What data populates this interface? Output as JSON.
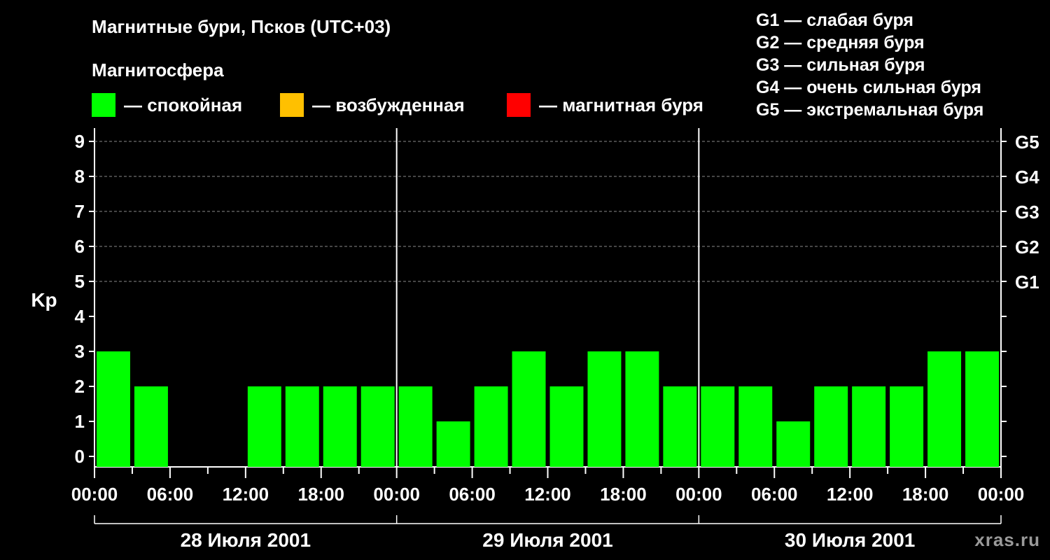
{
  "title": "Магнитные бури, Псков (UTC+03)",
  "subtitle": "Магнитосфера",
  "legend": [
    {
      "label": "— спокойная",
      "color": "#00ff00"
    },
    {
      "label": "— возбужденная",
      "color": "#ffc000"
    },
    {
      "label": "— магнитная буря",
      "color": "#ff0000"
    }
  ],
  "g_legend": [
    "G1 — слабая буря",
    "G2 — средняя буря",
    "G3 — сильная буря",
    "G4 — очень сильная буря",
    "G5 — экстремальная буря"
  ],
  "watermark": "xras.ru",
  "chart_data": {
    "type": "bar",
    "ylabel": "Kp",
    "ylim": [
      0,
      9
    ],
    "yticks": [
      0,
      1,
      2,
      3,
      4,
      5,
      6,
      7,
      8,
      9
    ],
    "right_axis": [
      {
        "kp": 5,
        "label": "G1"
      },
      {
        "kp": 6,
        "label": "G2"
      },
      {
        "kp": 7,
        "label": "G3"
      },
      {
        "kp": 8,
        "label": "G4"
      },
      {
        "kp": 9,
        "label": "G5"
      }
    ],
    "grid": "dashed horizontal lines at Kp 5–9",
    "x_tick_labels": [
      "00:00",
      "06:00",
      "12:00",
      "18:00",
      "00:00",
      "06:00",
      "12:00",
      "18:00",
      "00:00",
      "06:00",
      "12:00",
      "18:00",
      "00:00"
    ],
    "days": [
      "28 Июля 2001",
      "29 Июля 2001",
      "30 Июля 2001"
    ],
    "bar_interval_hours": 3,
    "color": "#00ff00",
    "values": [
      3,
      2,
      0,
      0,
      2,
      2,
      2,
      2,
      2,
      1,
      2,
      3,
      2,
      3,
      3,
      2,
      2,
      2,
      1,
      2,
      2,
      2,
      3,
      3
    ]
  }
}
